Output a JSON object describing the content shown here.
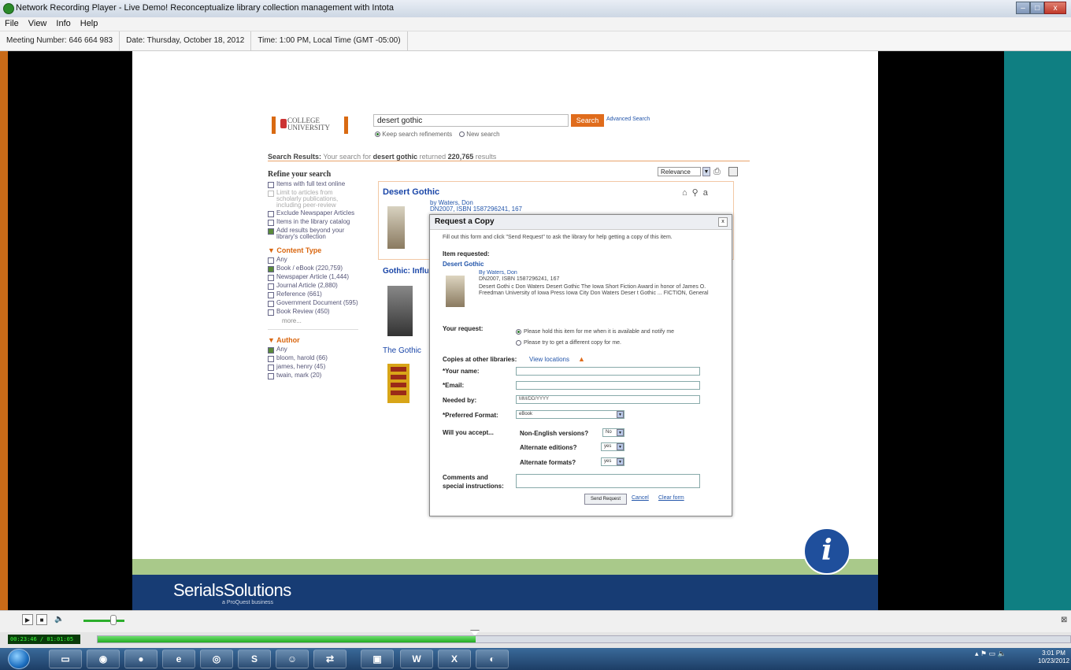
{
  "window": {
    "title": "Network Recording Player - Live Demo! Reconceptualize library collection management with Intota"
  },
  "menu": [
    "File",
    "View",
    "Info",
    "Help"
  ],
  "meeting": {
    "number": "Meeting Number: 646 664 983",
    "date": "Date: Thursday, October 18, 2012",
    "time": "Time: 1:00 PM, Local Time (GMT -05:00)"
  },
  "library": {
    "logo_line1": "COLLEGE",
    "logo_line2": "UNIVERSITY",
    "search_value": "desert gothic",
    "search_button": "Search",
    "advanced_search": "Advanced Search",
    "keep_refinements": "Keep search refinements",
    "new_search": "New search",
    "results_prefix": "Search Results:",
    "results_text": "Your search for",
    "results_query": "desert gothic",
    "results_returned": "returned",
    "results_count": "220,765",
    "results_suffix": "results",
    "relevance": "Relevance",
    "refine": {
      "heading": "Refine your search",
      "options": [
        {
          "label": "Items with full text online",
          "checked": false
        },
        {
          "label": "Limit to articles from scholarly publications, including peer-review",
          "checked": false,
          "disabled": true
        },
        {
          "label": "Exclude Newspaper Articles",
          "checked": false
        },
        {
          "label": "Items in the library catalog",
          "checked": false
        },
        {
          "label": "Add results beyond your library's collection",
          "checked": true
        }
      ],
      "content_type_heading": "Content Type",
      "content_types": [
        {
          "label": "Any",
          "checked": false
        },
        {
          "label": "Book / eBook (220,759)",
          "checked": true
        },
        {
          "label": "Newspaper Article (1,444)",
          "checked": false
        },
        {
          "label": "Journal Article (2,880)",
          "checked": false
        },
        {
          "label": "Reference (661)",
          "checked": false
        },
        {
          "label": "Government Document (595)",
          "checked": false
        },
        {
          "label": "Book Review (450)",
          "checked": false
        }
      ],
      "more": "more...",
      "author_heading": "Author",
      "authors": [
        {
          "label": "Any",
          "checked": true
        },
        {
          "label": "bloom, harold (66)",
          "checked": false
        },
        {
          "label": "james, henry (45)",
          "checked": false
        },
        {
          "label": "twain, mark (20)",
          "checked": false
        }
      ]
    },
    "results": [
      {
        "title": "Desert Gothic",
        "by": "by Waters, Don",
        "isbn": "DN2007, ISBN 1587296241, 167"
      },
      {
        "title": "Gothic: Influ"
      },
      {
        "title": "The Gothic"
      }
    ]
  },
  "modal": {
    "title": "Request a Copy",
    "close": "x",
    "intro": "Fill out this form and click \"Send Request\" to ask the library for help getting a copy of this item.",
    "item_requested_label": "Item requested:",
    "item_title": "Desert Gothic",
    "item_by": "By Waters, Don",
    "item_isbn": "DN2007, ISBN 1587296241, 167",
    "item_desc1": "Desert Gothi c Don Waters Desert Gothic The Iowa Short Fiction Award in honor of James O.",
    "item_desc2": "Freedman University of Iowa Press Iowa City Don Waters Deser t Gothic ... FICTION, General",
    "your_request_label": "Your request:",
    "request_option1": "Please hold this item for me when it is available and notify me",
    "request_option2": "Please try to get a different copy for me.",
    "copies_label": "Copies at other libraries:",
    "view_locations": "View locations",
    "your_name_label": "*Your name:",
    "email_label": "*Email:",
    "needed_by_label": "Needed by:",
    "needed_by_placeholder": "MM/DD/YYYY",
    "preferred_format_label": "*Preferred Format:",
    "preferred_format_value": "eBook",
    "will_accept_label": "Will you accept...",
    "non_english_label": "Non-English versions?",
    "non_english_value": "No",
    "alt_editions_label": "Alternate editions?",
    "alt_editions_value": "yes",
    "alt_formats_label": "Alternate formats?",
    "alt_formats_value": "yes",
    "comments_label_1": "Comments and",
    "comments_label_2": "special instructions:",
    "send_button": "Send Request",
    "cancel": "Cancel",
    "clear_form": "Clear form"
  },
  "slide": {
    "brand": "SerialsSolutions",
    "brand_sub": "a ProQuest business"
  },
  "player": {
    "time": "00:23:46 / 01:01:05",
    "progress_fraction": 0.389
  },
  "taskbar": {
    "apps": [
      "explorer-icon",
      "chrome-icon",
      "firefox-icon",
      "ie-icon",
      "thunderbird-icon",
      "skype-icon",
      "paint-icon",
      "network-icon",
      "recorder-icon",
      "word-icon",
      "excel-icon",
      "player-icon"
    ],
    "clock_time": "3:01 PM",
    "clock_date": "10/23/2012"
  },
  "colors": {
    "accent": "#e06c1c",
    "banner": "#173c74",
    "progress": "#22aa22"
  }
}
